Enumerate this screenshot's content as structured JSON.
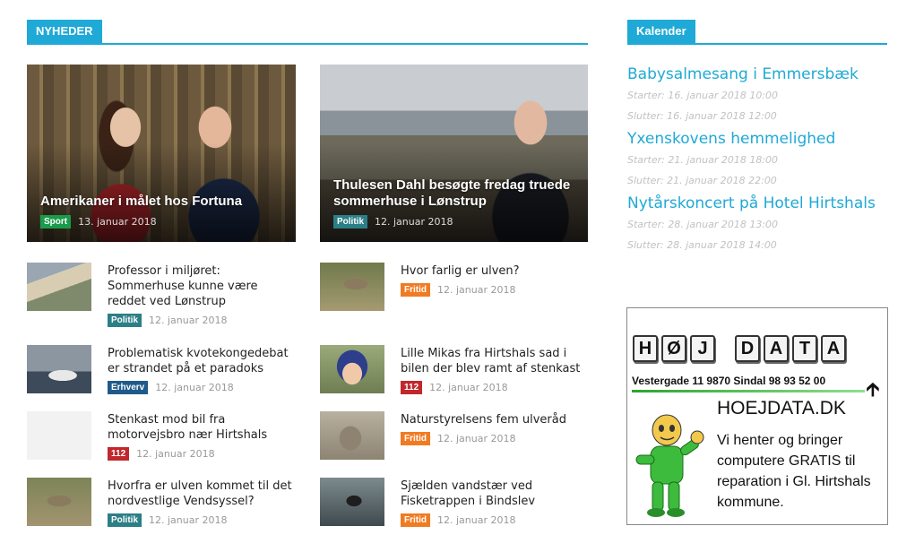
{
  "colors": {
    "accent": "#1fa9d6",
    "sport": "#1a9b4b",
    "politik": "#2b7f86",
    "erhverv": "#1f5a8a",
    "tag_112": "#c0282d",
    "fritid": "#f07b22"
  },
  "news": {
    "heading": "NYHEDER",
    "featured": [
      {
        "title": "Amerikaner i målet hos Fortuna",
        "category": "Sport",
        "date": "13. januar 2018"
      },
      {
        "title": "Thulesen Dahl besøgte fredag truede sommerhuse i Lønstrup",
        "category": "Politik",
        "date": "12. januar 2018"
      }
    ],
    "items": [
      {
        "title": "Professor i miljøret: Sommerhuse kunne være reddet ved Lønstrup",
        "category": "Politik",
        "date": "12. januar 2018"
      },
      {
        "title": "Hvor farlig er ulven?",
        "category": "Fritid",
        "date": "12. januar 2018"
      },
      {
        "title": "Problematisk kvotekongedebat er strandet på et paradoks",
        "category": "Erhverv",
        "date": "12. januar 2018"
      },
      {
        "title": "Lille Mikas fra Hirtshals sad i bilen der blev ramt af stenkast",
        "category": "112",
        "date": "12. januar 2018"
      },
      {
        "title": "Stenkast mod bil fra motorvejsbro nær Hirtshals",
        "category": "112",
        "date": "12. januar 2018"
      },
      {
        "title": "Naturstyrelsens fem ulveråd",
        "category": "Fritid",
        "date": "12. januar 2018"
      },
      {
        "title": "Hvorfra er ulven kommet til det nordvestlige Vendsyssel?",
        "category": "Politik",
        "date": "12. januar 2018"
      },
      {
        "title": "Sjælden vandstær ved Fisketrappen i Bindslev",
        "category": "Fritid",
        "date": "12. januar 2018"
      }
    ]
  },
  "calendar": {
    "heading": "Kalender",
    "events": [
      {
        "title": "Babysalmesang i Emmersbæk",
        "start": "Starter: 16. januar 2018 10:00",
        "end": "Slutter: 16. januar 2018 12:00"
      },
      {
        "title": "Yxenskovens hemmelighed",
        "start": "Starter: 21. januar 2018 18:00",
        "end": "Slutter: 21. januar 2018 22:00"
      },
      {
        "title": "Nytårskoncert på Hotel Hirtshals",
        "start": "Starter: 28. januar 2018 13:00",
        "end": "Slutter: 28. januar 2018 14:00"
      }
    ]
  },
  "ad": {
    "keys": [
      "H",
      "Ø",
      "J",
      "D",
      "A",
      "T",
      "A"
    ],
    "address": "Vestergade 11   9870 Sindal   98 93 52 00",
    "domain": "HOEJDATA.DK",
    "text": "Vi henter og bringer computere GRATIS til reparation i Gl. Hirtshals kommune.",
    "icons": [
      "cursor-arrow-icon",
      "thumbs-up-mascot"
    ]
  }
}
